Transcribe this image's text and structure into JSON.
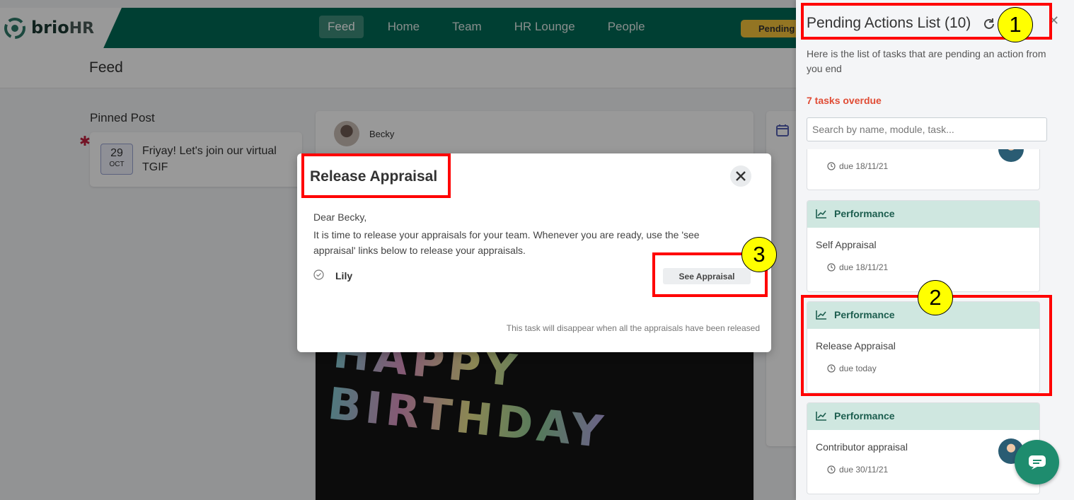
{
  "app": {
    "logo_text": "brio",
    "logo_text_hr": "HR",
    "nav": [
      "Feed",
      "Home",
      "Team",
      "HR Lounge",
      "People"
    ],
    "pending_button": "Pending",
    "page_title": "Feed"
  },
  "pinned": {
    "label": "Pinned Post",
    "day": "29",
    "month": "OCT",
    "text": "Friyay! Let's join our virtual TGIF"
  },
  "post": {
    "author": "Becky",
    "image_text": "HAPPY BIRTHDAY"
  },
  "panel": {
    "title": "Pending Actions List (10)",
    "description": "Here is the list of tasks that are pending an action from you end",
    "overdue": "7 tasks overdue",
    "search_placeholder": "Search by name, module, task...",
    "tasks": [
      {
        "module": "",
        "name": "",
        "due": "due 18/11/21"
      },
      {
        "module": "Performance",
        "name": "Self Appraisal",
        "due": "due 18/11/21"
      },
      {
        "module": "Performance",
        "name": "Release Appraisal",
        "due": "due today"
      },
      {
        "module": "Performance",
        "name": "Contributor appraisal",
        "due": "due 30/11/21"
      }
    ]
  },
  "modal": {
    "title": "Release Appraisal",
    "greeting": "Dear Becky,",
    "body": "It is time to release your appraisals for your team. Whenever you are ready, use the 'see appraisal' links below to release your appraisals.",
    "employee": "Lily",
    "button": "See Appraisal",
    "footer": "This task will disappear when all the appraisals have been released"
  },
  "annotations": [
    "1",
    "2",
    "3"
  ],
  "colors": {
    "brand": "#006a55",
    "highlight": "#ff0000",
    "badge": "#ffff00",
    "overdue": "#e04c35"
  }
}
